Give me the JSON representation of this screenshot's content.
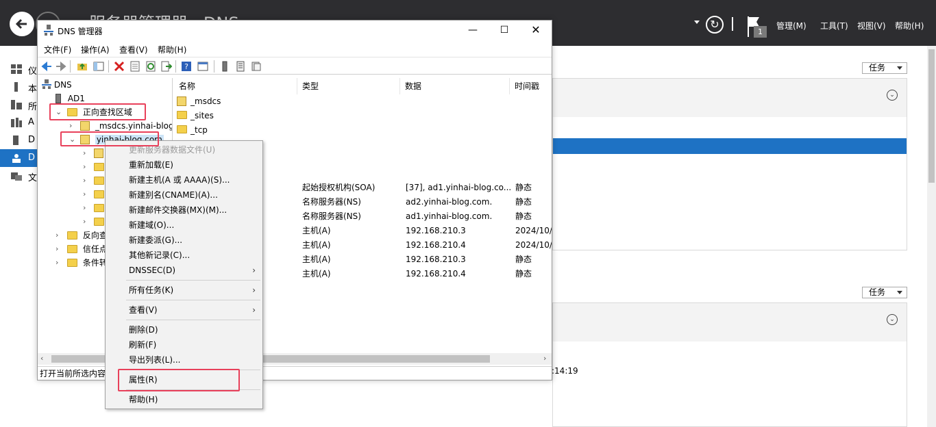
{
  "server_manager": {
    "title": "服务器管理器 · DNS",
    "menus": [
      "管理(M)",
      "工具(T)",
      "视图(V)",
      "帮助(H)"
    ],
    "flag_count": "1",
    "sidebar": [
      {
        "icon": "dashboard-icon",
        "label": "仪"
      },
      {
        "icon": "local-server-icon",
        "label": "本"
      },
      {
        "icon": "all-servers-icon",
        "label": "所"
      },
      {
        "icon": "ad-icon",
        "label": "A"
      },
      {
        "icon": "dhcp-icon",
        "label": "D"
      },
      {
        "icon": "dns-icon",
        "label": "D",
        "active": true
      },
      {
        "icon": "file-services-icon",
        "label": "文"
      }
    ],
    "task_label": "任务",
    "status_time_fragment": ":14:19"
  },
  "dns_window": {
    "title": "DNS 管理器",
    "menus": [
      "文件(F)",
      "操作(A)",
      "查看(V)",
      "帮助(H)"
    ],
    "tree": {
      "root": "DNS",
      "server": "AD1",
      "forward_zones": "正向查找区域",
      "msdcs_zone": "_msdcs.yinhai-blog",
      "selected_zone": "yinhai-blog.com",
      "reverse_zones": "反向查",
      "trust_points": "信任点",
      "conditional_forwarders": "条件转"
    },
    "columns": [
      "名称",
      "类型",
      "数据",
      "时间戳"
    ],
    "folders": [
      "_msdcs",
      "_sites",
      "_tcp"
    ],
    "records": [
      {
        "type": "起始授权机构(SOA)",
        "data": "[37], ad1.yinhai-blog.co...",
        "timestamp": "静态"
      },
      {
        "type": "名称服务器(NS)",
        "data": "ad2.yinhai-blog.com.",
        "timestamp": "静态"
      },
      {
        "type": "名称服务器(NS)",
        "data": "ad1.yinhai-blog.com.",
        "timestamp": "静态"
      },
      {
        "type": "主机(A)",
        "data": "192.168.210.3",
        "timestamp": "2024/10/"
      },
      {
        "type": "主机(A)",
        "data": "192.168.210.4",
        "timestamp": "2024/10/"
      },
      {
        "type": "主机(A)",
        "data": "192.168.210.3",
        "timestamp": "静态"
      },
      {
        "type": "主机(A)",
        "data": "192.168.210.4",
        "timestamp": "静态"
      }
    ],
    "status": "打开当前所选内容"
  },
  "context_menu": {
    "update_file": "更新服务器数据文件(U)",
    "reload": "重新加载(E)",
    "new_host": "新建主机(A 或 AAAA)(S)...",
    "new_alias": "新建别名(CNAME)(A)...",
    "new_mx": "新建邮件交换器(MX)(M)...",
    "new_domain": "新建域(O)...",
    "new_delegation": "新建委派(G)...",
    "other_records": "其他新记录(C)...",
    "dnssec": "DNSSEC(D)",
    "all_tasks": "所有任务(K)",
    "view": "查看(V)",
    "delete": "删除(D)",
    "refresh": "刷新(F)",
    "export": "导出列表(L)...",
    "properties": "属性(R)",
    "help": "帮助(H)"
  },
  "colors": {
    "header_bg": "#2d2d30",
    "accent_blue": "#1e72c4",
    "highlight_red": "#e8405a"
  }
}
